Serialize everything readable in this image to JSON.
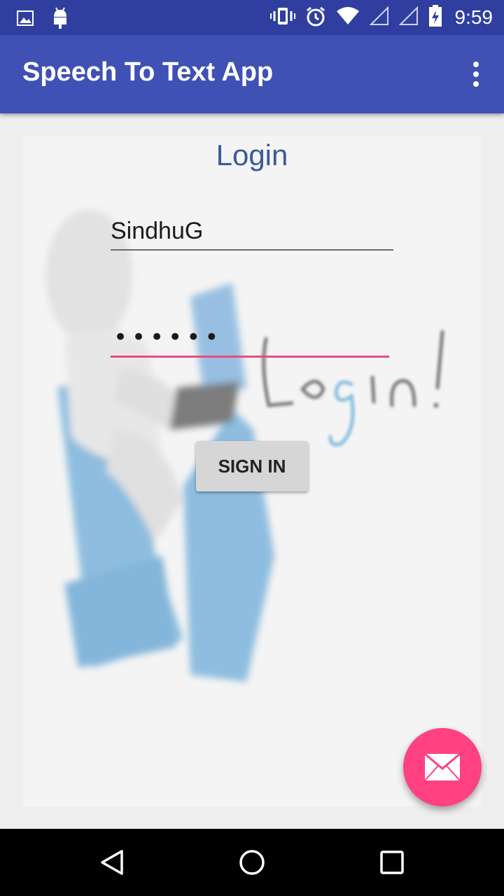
{
  "status_bar": {
    "time": "9:59",
    "left_icons": [
      "gallery-icon",
      "android-icon"
    ],
    "right_icons": [
      "vibrate-icon",
      "alarm-icon",
      "wifi-icon",
      "signal-icon",
      "signal-icon",
      "battery-charging-icon"
    ]
  },
  "app_bar": {
    "title": "Speech To Text App",
    "menu_icon": "overflow-menu-icon"
  },
  "login": {
    "heading": "Login",
    "username_value": "SindhuG",
    "password_value": "••••••",
    "signin_label": "SIGN IN",
    "background_image_text": "Login!"
  },
  "fab": {
    "icon": "mail-icon"
  },
  "nav_bar": {
    "buttons": [
      "back-icon",
      "home-icon",
      "recents-icon"
    ]
  },
  "colors": {
    "status_bar": "#303f9f",
    "app_bar": "#3f51b5",
    "accent": "#ff4081",
    "heading": "#3b5a9a",
    "active_underline": "#e84c7d"
  }
}
